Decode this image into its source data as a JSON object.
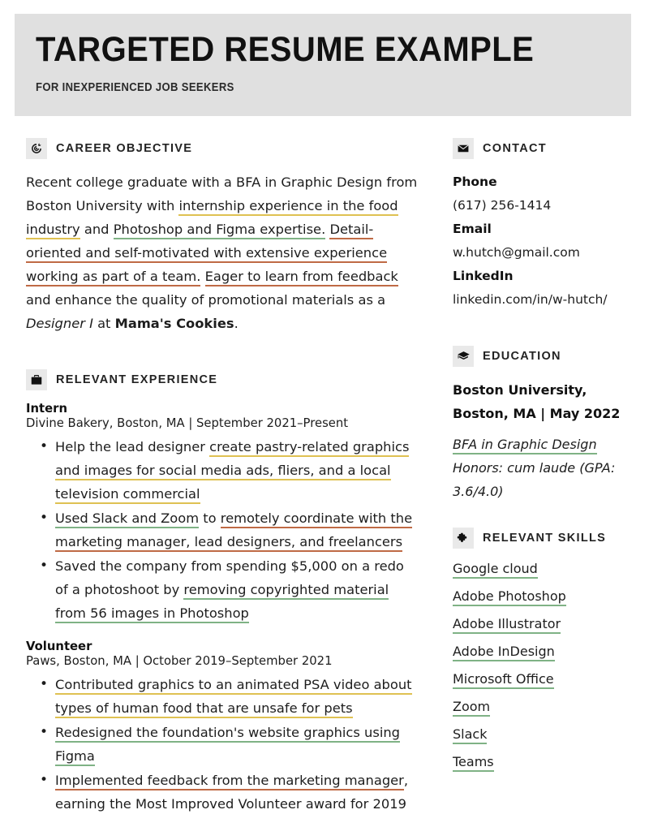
{
  "header": {
    "title": "TARGETED RESUME EXAMPLE",
    "subtitle": "FOR INEXPERIENCED JOB SEEKERS",
    "background_color": "#e0e0e0"
  },
  "colors": {
    "gold": "#dfc152",
    "green": "#7fb285",
    "rust": "#bf6a45",
    "header_band": "#e0e0e0",
    "icon_box": "#e9e9e9",
    "text": "#1d1d1d"
  },
  "sections": {
    "career_objective": {
      "title": "CAREER OBJECTIVE",
      "icon": "target-icon",
      "text_parts": [
        {
          "text": "Recent college graduate with a BFA in Graphic Design from Boston University with ",
          "style": "plain"
        },
        {
          "text": "internship experience in the food industry",
          "style": "underline-gold"
        },
        {
          "text": " and ",
          "style": "plain"
        },
        {
          "text": "Photoshop and Figma expertise.",
          "style": "underline-green"
        },
        {
          "text": " ",
          "style": "plain"
        },
        {
          "text": "Detail-oriented and self-motivated with extensive experience working as part of a team.",
          "style": "underline-rust"
        },
        {
          "text": " ",
          "style": "plain"
        },
        {
          "text": "Eager to learn from feedback",
          "style": "underline-rust"
        },
        {
          "text": " and enhance the quality of promotional materials as a ",
          "style": "plain"
        },
        {
          "text": "Designer I",
          "style": "italic"
        },
        {
          "text": " at ",
          "style": "plain"
        },
        {
          "text": "Mama's Cookies",
          "style": "bold"
        },
        {
          "text": ".",
          "style": "plain"
        }
      ]
    },
    "relevant_experience": {
      "title": "RELEVANT EXPERIENCE",
      "icon": "briefcase-icon",
      "jobs": [
        {
          "title": "Intern",
          "meta": "Divine Bakery, Boston, MA | September 2021–Present",
          "bullets": [
            [
              {
                "text": "Help the lead designer ",
                "style": "plain"
              },
              {
                "text": "create pastry-related graphics and images for social media ads, fliers, and a local television commercial",
                "style": "underline-gold"
              }
            ],
            [
              {
                "text": "Used Slack and Zoom",
                "style": "underline-green"
              },
              {
                "text": " to ",
                "style": "plain"
              },
              {
                "text": "remotely coordinate with the marketing manager, lead designers, and freelancers",
                "style": "underline-rust"
              }
            ],
            [
              {
                "text": "Saved the company from spending $5,000 on a redo of a photoshoot by ",
                "style": "plain"
              },
              {
                "text": "removing copyrighted material from 56 images in Photoshop",
                "style": "underline-green"
              }
            ]
          ]
        },
        {
          "title": "Volunteer",
          "meta": "Paws, Boston, MA | October 2019–September 2021",
          "bullets": [
            [
              {
                "text": "Contributed graphics to an animated PSA video about types of human food that are unsafe for pets",
                "style": "underline-gold"
              }
            ],
            [
              {
                "text": "Redesigned the foundation's website graphics using Figma",
                "style": "underline-green"
              }
            ],
            [
              {
                "text": "Implemented feedback from the marketing manager",
                "style": "underline-rust"
              },
              {
                "text": ", earning the Most Improved Volunteer award for 2019",
                "style": "plain"
              }
            ]
          ]
        }
      ]
    },
    "contact": {
      "title": "CONTACT",
      "icon": "envelope-icon",
      "entries": [
        {
          "label": "Phone",
          "value": "(617) 256-1414"
        },
        {
          "label": "Email",
          "value": "w.hutch@gmail.com"
        },
        {
          "label": "LinkedIn",
          "value": "linkedin.com/in/w-hutch/"
        }
      ]
    },
    "education": {
      "title": "EDUCATION",
      "icon": "graduation-cap-icon",
      "school_line1": "Boston University,",
      "school_line2": "Boston, MA | May 2022",
      "degree": "BFA in Graphic Design",
      "honors": "Honors: cum laude (GPA: 3.6/4.0)"
    },
    "relevant_skills": {
      "title": "RELEVANT SKILLS",
      "icon": "puzzle-piece-icon",
      "items": [
        "Google cloud",
        "Adobe Photoshop",
        "Adobe Illustrator",
        "Adobe InDesign",
        "Microsoft Office",
        "Zoom",
        "Slack",
        "Teams"
      ]
    }
  }
}
